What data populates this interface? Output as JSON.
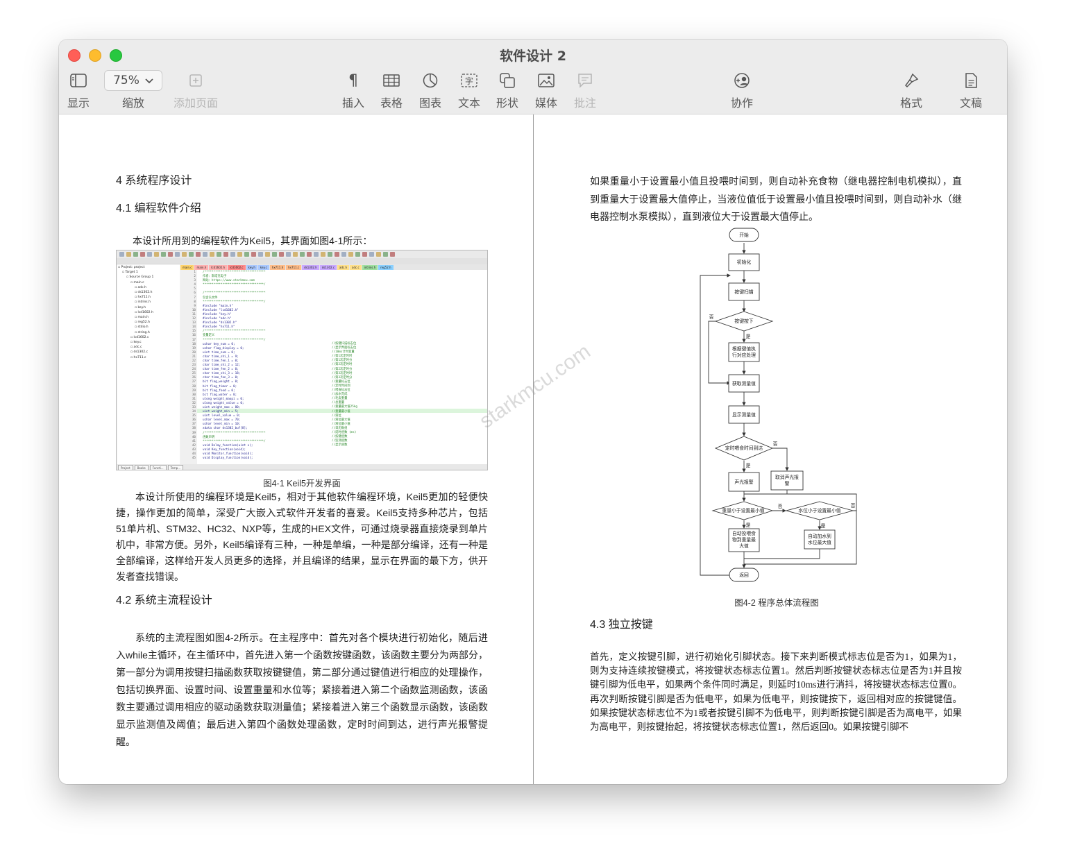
{
  "window": {
    "title": "软件设计 2"
  },
  "toolbar": {
    "display_label": "显示",
    "zoom_value": "75%",
    "zoom_label": "缩放",
    "add_page_label": "添加页面",
    "insert_label": "插入",
    "table_label": "表格",
    "chart_label": "图表",
    "text_label": "文本",
    "shape_label": "形状",
    "media_label": "媒体",
    "comment_label": "批注",
    "collaborate_label": "协作",
    "format_label": "格式",
    "document_label": "文稿"
  },
  "left_page": {
    "heading_4": "4 系统程序设计",
    "heading_4_1": "4.1 编程软件介绍",
    "intro": "本设计所用到的编程软件为Keil5，其界面如图4-1所示：",
    "fig_caption": "图4-1 Keil5开发界面",
    "para_1": "本设计所使用的编程环境是Keil5，相对于其他软件编程环境，Keil5更加的轻便快捷，操作更加的简单，深受广大嵌入式软件开发者的喜爱。Keil5支持多种芯片，包括51单片机、STM32、HC32、NXP等，生成的HEX文件，可通过烧录器直接烧录到单片机中，非常方便。另外，Keil5编译有三种，一种是单编，一种是部分编译，还有一种是全部编译，这样给开发人员更多的选择，并且编译的结果，显示在界面的最下方，供开发者查找错误。",
    "heading_4_2": "4.2 系统主流程设计",
    "para_2": "系统的主流程图如图4-2所示。在主程序中：首先对各个模块进行初始化，随后进入while主循环，在主循环中，首先进入第一个函数按键函数，该函数主要分为两部分，第一部分为调用按键扫描函数获取按键键值，第二部分通过键值进行相应的处理操作，包括切换界面、设置时间、设置重量和水位等；紧接着进入第二个函数监测函数，该函数主要通过调用相应的驱动函数获取测量值；紧接着进入第三个函数显示函数，该函数显示监测值及阈值；最后进入第四个函数处理函数，定时时间到达，进行声光报警提醒。"
  },
  "keil_screenshot": {
    "project_tree": [
      "Project: project",
      "Target 1",
      "Source Group 1",
      "main.c",
      "adc.h",
      "ds1302.h",
      "hx711.h",
      "intrins.h",
      "key.h",
      "lcd1602.h",
      "main.h",
      "reg52.h",
      "stdio.h",
      "string.h",
      "lcd1602.c",
      "key.c",
      "adc.c",
      "ds1302.c",
      "hx711.c"
    ],
    "file_tabs": [
      "main.c",
      "main.h",
      "lcd1602.h",
      "lcd1602.c",
      "key.h",
      "key.c",
      "hx711.h",
      "hx711.c",
      "ds1302.h",
      "ds1302.c",
      "adc.h",
      "adc.c",
      "intrins.h",
      "reg52.h"
    ],
    "code_lines": [
      "/**********************************",
      "作者：斯塔克电子",
      "网站：https://www.starkmcu.com",
      "**********************************/",
      "",
      "/**********************************",
      "包含头文件",
      "**********************************/",
      "#include \"main.h\"",
      "#include \"lcd1602.h\"",
      "#include \"key.h\"",
      "#include \"adc.h\"",
      "#include \"ds1302.h\"",
      "#include \"hx711.h\"",
      "/**********************************",
      "变量定义",
      "**********************************/",
      "uchar key_num = 0;",
      "uchar flag_display = 0;",
      "uint time_num = 0;",
      "char time_shi_1 = 9;",
      "char time_fen_1 = 0;",
      "char time_shi_2 = 12;",
      "char time_fen_2 = 0;",
      "char time_shi_3 = 18;",
      "char time_fen_3 = 0;",
      "bit flag_weight = 0;",
      "bit flag_timer = 0;",
      "bit flag_food = 0;",
      "bit flag_water = 0;",
      "ulong weight_maopi = 0;",
      "ulong weight_value = 0;",
      "uint weight_max = 80;",
      "uint weight_min = 5;",
      "uint level_value = 0;",
      "uchar level_max = 70;",
      "uchar level_min = 10;",
      "xdata char ds1302_buf[8];",
      "/**********************************",
      "函数声明",
      "**********************************/",
      "void Delay_function(uint x);",
      "void Key_function(void);",
      "void Monitor_function(void);",
      "void Display_function(void);"
    ],
    "code_comments": [
      "//按键扫描标志位",
      "//显示界面标志位",
      "//10ms计时变量",
      "//第1次定时时",
      "//第1次定时分",
      "//第2次定时时",
      "//第2次定时分",
      "//第3次定时时",
      "//第3次定时分",
      "//重量标志位",
      "//定时时间到",
      "//喂食标志位",
      "//加水完成",
      "//毛皮重量",
      "//总重量",
      "//重量最大值25kg",
      "//重量最小值",
      "//液位",
      "//液位最大值",
      "//液位最小值",
      "//日历数组",
      "//延时函数 (ms)",
      "//按键函数",
      "//监测函数",
      "//显示函数"
    ],
    "bottom_tabs": [
      "Project",
      "Books",
      "Functi...",
      "Temp..."
    ]
  },
  "right_page": {
    "para_top": "如果重量小于设置最小值且投喂时间到，则自动补充食物（继电器控制电机模拟），直到重量大于设置最大值停止，当液位值低于设置最小值且投喂时间到，则自动补水（继电器控制水泵模拟），直到液位大于设置最大值停止。",
    "fig_caption": "图4-2    程序总体流程图",
    "heading_4_3": "4.3 独立按键",
    "para_bottom": "首先，定义按键引脚，进行初始化引脚状态。接下来判断模式标志位是否为1，如果为1，则为支持连续按键模式，将按键状态标志位置1。然后判断按键状态标志位是否为1并且按键引脚为低电平，如果两个条件同时满足，则延时10ms进行消抖，将按键状态标志位置0。再次判断按键引脚是否为低电平，如果为低电平，则按键按下，返回相对应的按键键值。如果按键状态标志位不为1或者按键引脚不为低电平，则判断按键引脚是否为高电平，如果为高电平，则按键抬起，将按键状态标志位置1，然后返回0。如果按键引脚不"
  },
  "flowchart": {
    "start": "开始",
    "init": "初始化",
    "key_scan": "按键扫描",
    "key_pressed": "按键按下",
    "key_process_1": "根据键值执",
    "key_process_2": "行对应处理",
    "get_value": "获取测量值",
    "show_value": "显示测量值",
    "timer_check": "定时喂食时间到达",
    "alarm": "声光报警",
    "cancel_alarm_1": "取消声光报",
    "cancel_alarm_2": "警",
    "weight_check": "重量小于设置最小值",
    "water_check": "水位小于设置最小值",
    "feed_1": "自动投喂食",
    "feed_2": "物到重量最",
    "feed_3": "大值",
    "water_1": "自动加水到",
    "water_2": "水位最大值",
    "return": "返回",
    "yes": "是",
    "no": "否"
  },
  "watermark": "starkmcu.com"
}
